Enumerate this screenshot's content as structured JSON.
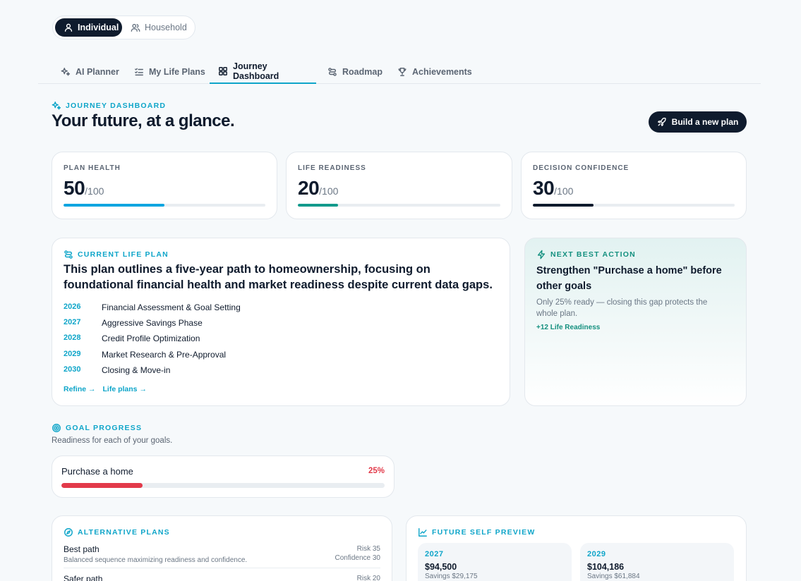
{
  "mode_toggle": {
    "individual": "Individual",
    "household": "Household"
  },
  "tabs": [
    "AI Planner",
    "My Life Plans",
    "Journey Dashboard",
    "Roadmap",
    "Achievements"
  ],
  "header": {
    "eyebrow": "JOURNEY DASHBOARD",
    "title": "Your future, at a glance.",
    "cta": "Build a new plan"
  },
  "metrics": [
    {
      "label": "PLAN HEALTH",
      "value": "50",
      "denominator": "/100",
      "progress": 0.5,
      "color": "#0ea5e0"
    },
    {
      "label": "LIFE READINESS",
      "value": "20",
      "denominator": "/100",
      "progress": 0.2,
      "color": "#139a8c"
    },
    {
      "label": "DECISION CONFIDENCE",
      "value": "30",
      "denominator": "/100",
      "progress": 0.3,
      "color": "#0f1b2d"
    }
  ],
  "current_plan": {
    "eyebrow": "CURRENT LIFE PLAN",
    "summary": "This plan outlines a five-year path to homeownership, focusing on foundational financial health and market readiness despite current data gaps.",
    "timeline": [
      {
        "year": "2026",
        "text": "Financial Assessment & Goal Setting"
      },
      {
        "year": "2027",
        "text": "Aggressive Savings Phase"
      },
      {
        "year": "2028",
        "text": "Credit Profile Optimization"
      },
      {
        "year": "2029",
        "text": "Market Research & Pre-Approval"
      },
      {
        "year": "2030",
        "text": "Closing & Move-in"
      }
    ],
    "refine": "Refine",
    "life_plans": "Life plans"
  },
  "next_action": {
    "eyebrow": "NEXT BEST ACTION",
    "title": "Strengthen \"Purchase a home\" before other goals",
    "subtitle": "Only 25% ready — closing this gap protects the whole plan.",
    "tag": "+12 Life Readiness"
  },
  "goal_progress": {
    "eyebrow": "GOAL PROGRESS",
    "subtitle": "Readiness for each of your goals.",
    "goals": [
      {
        "name": "Purchase a home",
        "percent_label": "25%",
        "progress": 0.25,
        "color": "#e23a4a"
      }
    ]
  },
  "alternatives": {
    "eyebrow": "ALTERNATIVE PLANS",
    "plans": [
      {
        "name": "Best path",
        "desc": "Balanced sequence maximizing readiness and confidence.",
        "risk": "Risk 35",
        "confidence": "Confidence 30"
      },
      {
        "name": "Safer path",
        "desc": "",
        "risk": "Risk 20",
        "confidence": ""
      }
    ]
  },
  "future_self": {
    "eyebrow": "FUTURE SELF PREVIEW",
    "items": [
      {
        "year": "2027",
        "value": "$94,500",
        "savings": "Savings $29,175"
      },
      {
        "year": "2029",
        "value": "$104,186",
        "savings": "Savings $61,884"
      }
    ]
  }
}
